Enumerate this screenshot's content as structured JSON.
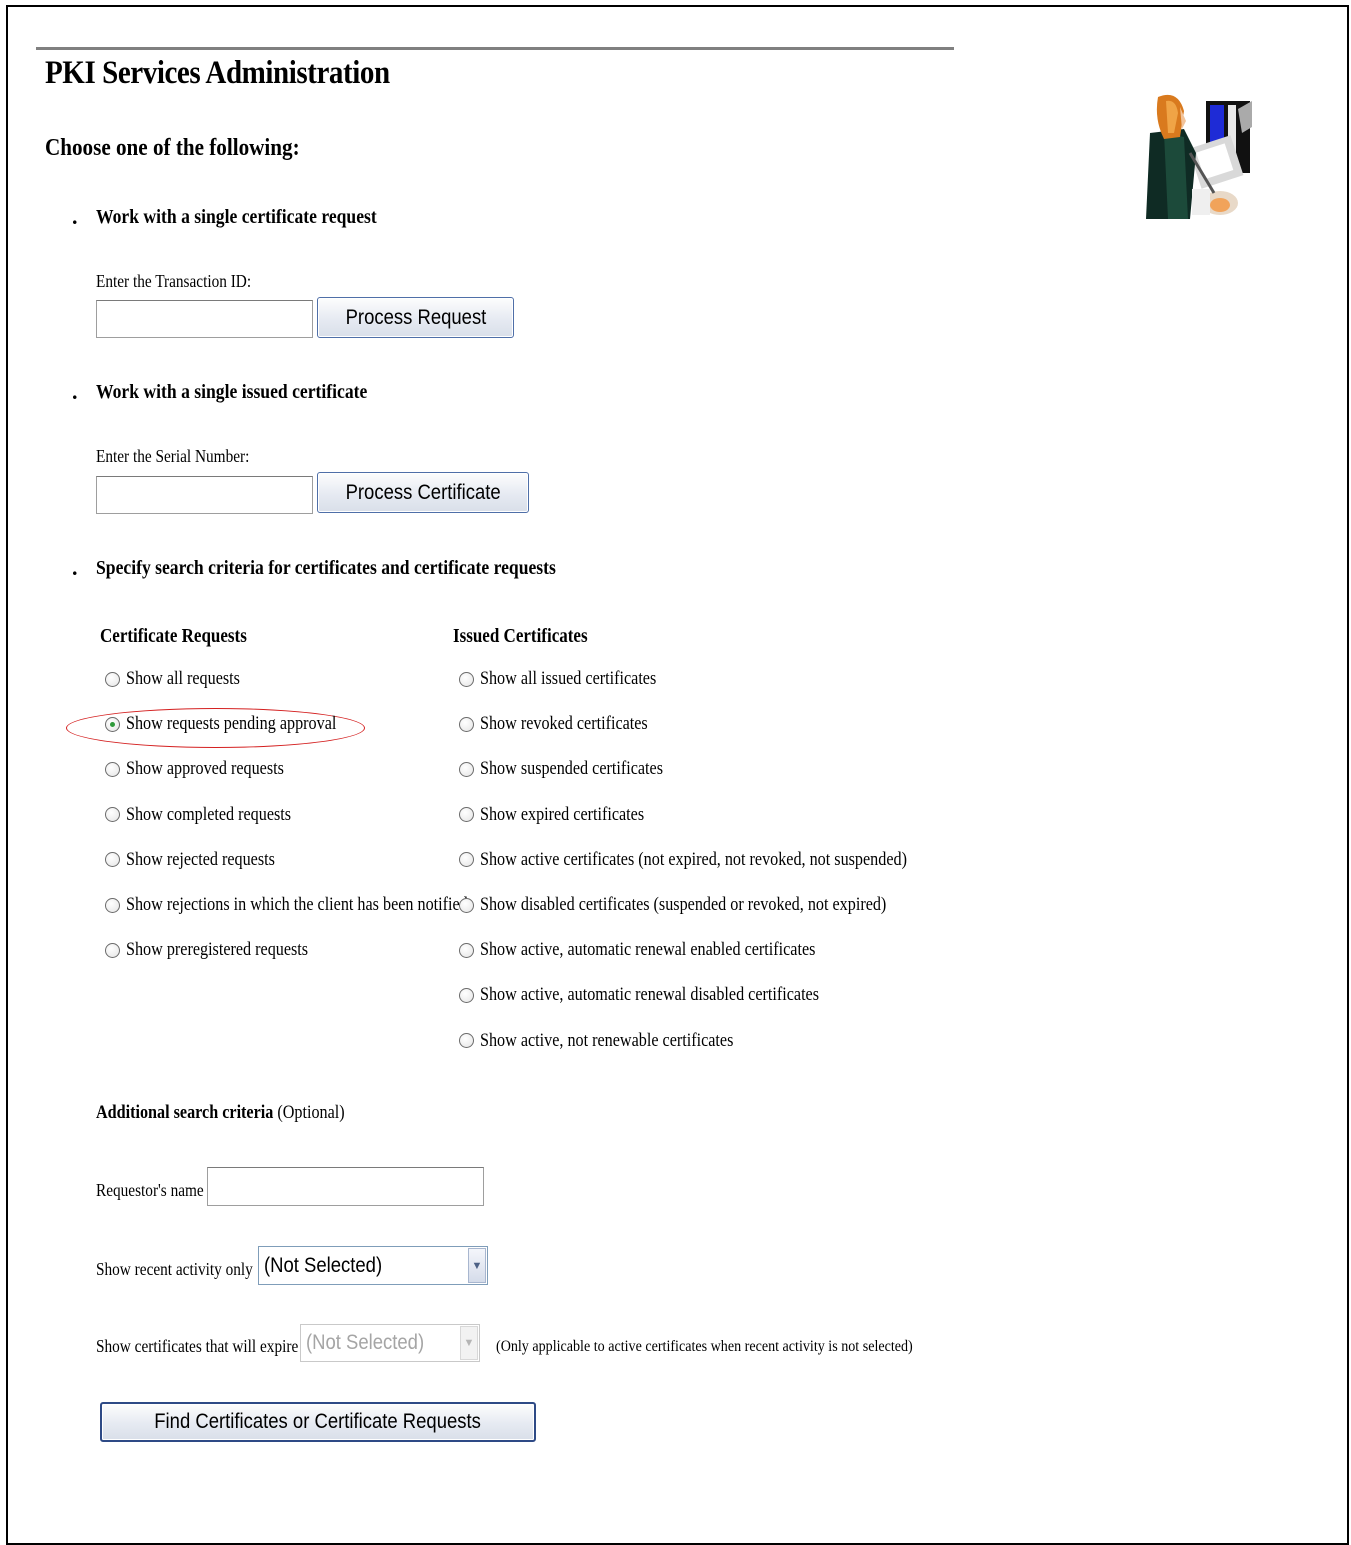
{
  "page": {
    "title": "PKI Services Administration",
    "instruction": "Choose one of the following:"
  },
  "single_request": {
    "heading": "Work with a single certificate request",
    "label": "Enter the Transaction ID:",
    "value": "",
    "button": "Process Request"
  },
  "single_certificate": {
    "heading": "Work with a single issued certificate",
    "label": "Enter the Serial Number:",
    "value": "",
    "button": "Process Certificate"
  },
  "search": {
    "heading": "Specify search criteria for certificates and certificate requests",
    "requests_heading": "Certificate Requests",
    "requests_options": [
      "Show all requests",
      "Show requests pending approval",
      "Show approved requests",
      "Show completed requests",
      "Show rejected requests",
      "Show rejections in which the client has been notified",
      "Show preregistered requests"
    ],
    "requests_selected_index": 1,
    "issued_heading": "Issued Certificates",
    "issued_options": [
      "Show all issued certificates",
      "Show revoked certificates",
      "Show suspended certificates",
      "Show expired certificates",
      "Show active certificates (not expired, not revoked, not suspended)",
      "Show disabled certificates (suspended or revoked, not expired)",
      "Show active, automatic renewal enabled certificates",
      "Show active, automatic renewal disabled certificates",
      "Show active, not renewable certificates"
    ]
  },
  "additional": {
    "heading": "Additional search criteria",
    "optional": "(Optional)",
    "requestor_label": "Requestor's name",
    "requestor_value": "",
    "recent_label": "Show recent activity only",
    "recent_value": "(Not Selected)",
    "expire_label": "Show certificates that will expire",
    "expire_value": "(Not Selected)",
    "expire_note": "(Only applicable to active certificates when recent activity is not selected)",
    "find_button": "Find Certificates or Certificate Requests"
  },
  "colors": {
    "highlight": "#d42020",
    "button_border": "#4f6fa8",
    "radio_checked": "#2e9a3a"
  }
}
